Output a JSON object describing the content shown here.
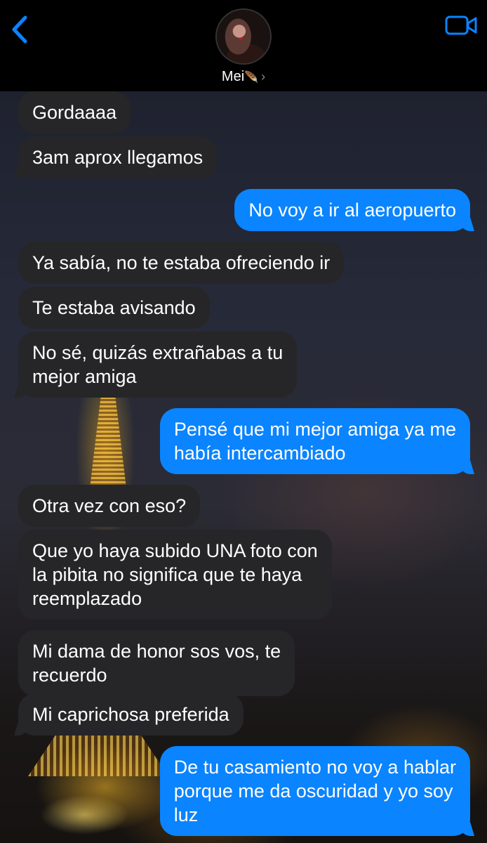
{
  "header": {
    "contact_name": "Mei",
    "contact_emoji": "🪶",
    "chevron": "›",
    "back_icon": "chevron-left-icon",
    "video_icon": "video-camera-icon"
  },
  "colors": {
    "accent": "#0a84ff",
    "incoming_bubble": "#262628",
    "header_bg": "#000000"
  },
  "messages": [
    {
      "from": "them",
      "text": "Gordaaaa"
    },
    {
      "from": "them",
      "text": "3am aprox llegamos"
    },
    {
      "from": "me",
      "text": "No voy a ir al aeropuerto"
    },
    {
      "from": "them",
      "text": "Ya sabía, no te estaba ofreciendo ir"
    },
    {
      "from": "them",
      "text": "Te estaba avisando"
    },
    {
      "from": "them",
      "text": "No sé, quizás extrañabas a tu\nmejor amiga"
    },
    {
      "from": "me",
      "text": "Pensé que mi mejor amiga ya me\nhabía intercambiado"
    },
    {
      "from": "them",
      "text": "Otra vez con eso?"
    },
    {
      "from": "them",
      "text": "Que yo haya subido UNA foto con\nla pibita no significa que te haya\nreemplazado"
    },
    {
      "from": "them",
      "text": "Mi dama de honor sos vos, te\nrecuerdo"
    },
    {
      "from": "them",
      "text": "Mi caprichosa preferida"
    },
    {
      "from": "me",
      "text": "De tu casamiento no voy a hablar\nporque me da oscuridad y yo soy\nluz"
    }
  ]
}
